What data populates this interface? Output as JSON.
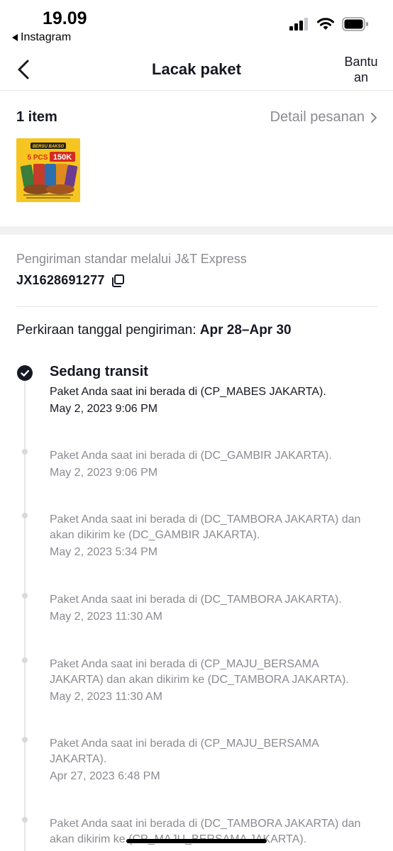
{
  "status_bar": {
    "time": "19.09",
    "back_app": "Instagram"
  },
  "nav": {
    "title": "Lacak paket",
    "help": "Bantuan"
  },
  "order": {
    "item_count": "1 item",
    "detail_link": "Detail pesanan"
  },
  "product_image": {
    "badge_top": "BERSU BAKSO",
    "promo_qty": "5 PCS",
    "promo_price": "150K"
  },
  "shipping": {
    "method": "Pengiriman standar melalui J&T Express",
    "tracking_number": "JX1628691277",
    "eta_label": "Perkiraan tanggal pengiriman:",
    "eta_value": "Apr 28–Apr 30"
  },
  "timeline": {
    "current_status": "Sedang transit",
    "events": [
      {
        "text": "Paket Anda saat ini berada di (CP_MABES JAKARTA).",
        "date": "May 2, 2023 9:06 PM"
      },
      {
        "text": "Paket Anda saat ini berada di (DC_GAMBIR JAKARTA).",
        "date": "May 2, 2023 9:06 PM"
      },
      {
        "text": "Paket Anda saat ini berada di (DC_TAMBORA JAKARTA) dan akan dikirim ke (DC_GAMBIR JAKARTA).",
        "date": "May 2, 2023 5:34 PM"
      },
      {
        "text": "Paket Anda saat ini berada di (DC_TAMBORA JAKARTA).",
        "date": "May 2, 2023 11:30 AM"
      },
      {
        "text": "Paket Anda saat ini berada di (CP_MAJU_BERSAMA JAKARTA) dan akan dikirim ke (DC_TAMBORA JAKARTA).",
        "date": "May 2, 2023 11:30 AM"
      },
      {
        "text": "Paket Anda saat ini berada di (CP_MAJU_BERSAMA JAKARTA).",
        "date": "Apr 27, 2023 6:48 PM"
      },
      {
        "text": "Paket Anda saat ini berada di (DC_TAMBORA JAKARTA) dan akan dikirim ke (CP_MAJU_BERSAMA JAKARTA).",
        "date": ""
      }
    ]
  }
}
